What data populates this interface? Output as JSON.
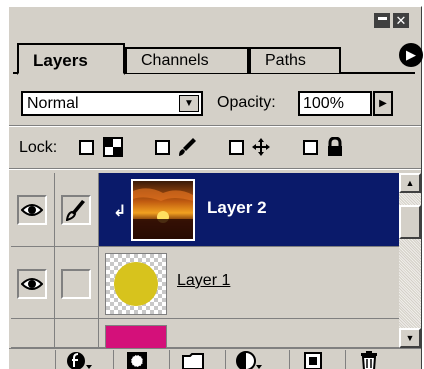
{
  "tabs": [
    {
      "label": "Layers",
      "active": true
    },
    {
      "label": "Channels",
      "active": false
    },
    {
      "label": "Paths",
      "active": false
    }
  ],
  "blend_mode": "Normal",
  "opacity_label": "Opacity:",
  "opacity_value": "100%",
  "lock_label": "Lock:",
  "layers": [
    {
      "name": "Layer 2",
      "selected": true,
      "visible": true,
      "clipped": true
    },
    {
      "name": "Layer 1",
      "selected": false,
      "visible": true
    }
  ],
  "colors": {
    "panel_bg": "#d4d0c8",
    "selected_row": "#0a1a6a",
    "circle": "#d7c31d",
    "pink_layer": "#d4107a"
  },
  "icons": [
    "minimize-icon",
    "close-icon",
    "panel-menu-icon",
    "eye-icon",
    "brush-icon",
    "clip-arrow-icon",
    "transparency-lock-icon",
    "paint-lock-icon",
    "move-lock-icon",
    "all-lock-icon",
    "layer-style-icon",
    "mask-icon",
    "new-set-icon",
    "adjustment-icon",
    "new-layer-icon",
    "trash-icon"
  ]
}
